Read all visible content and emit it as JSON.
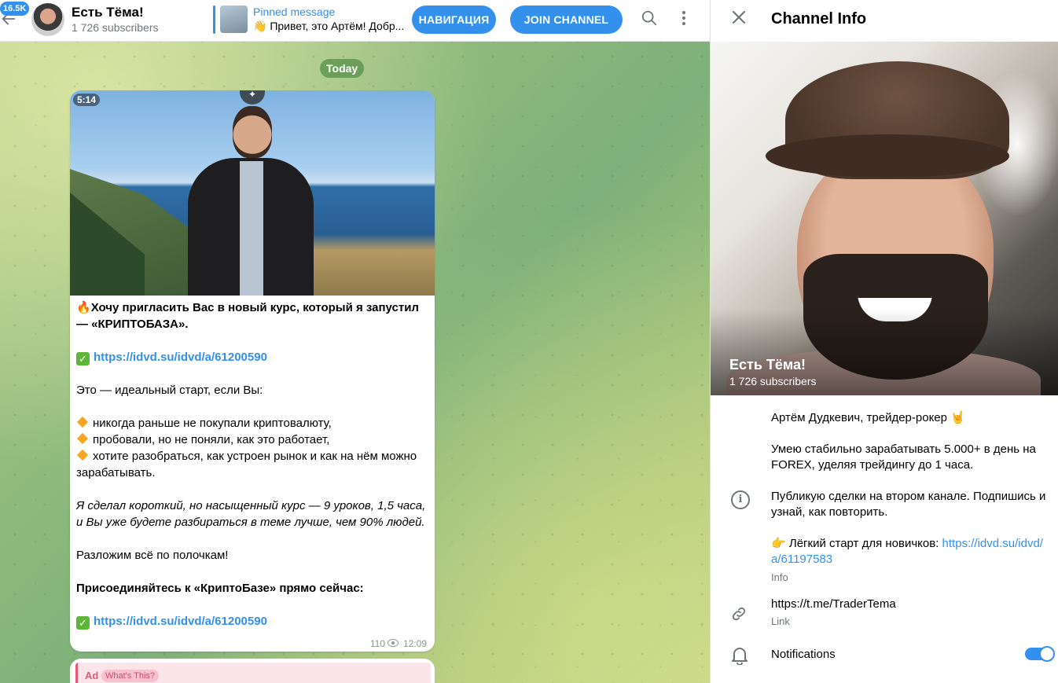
{
  "header": {
    "unread_count": "16.5K",
    "chat_title": "Есть Тёма!",
    "chat_subtitle": "1 726 subscribers",
    "pinned_title": "Pinned message",
    "pinned_text": "👋 Привет, это Артём! Добр...",
    "nav_button": "НАВИГАЦИЯ",
    "join_button": "JOIN CHANNEL"
  },
  "chat": {
    "date_separator": "Today",
    "message": {
      "video_duration": "5:14",
      "lines": {
        "intro": "Хочу пригласить Вас в новый курс, который я запустил — «КРИПТОБАЗА».",
        "link1": "https://idvd.su/idvd/a/61200590",
        "ideal": "Это — идеальный старт, если Вы:",
        "bullet1": "никогда раньше не покупали криптовалюту,",
        "bullet2": "пробовали, но не поняли, как это работает,",
        "bullet3": "хотите разобраться, как устроен рынок и как на нём можно зарабатывать.",
        "italic": "Я сделал короткий, но насыщенный курс — 9 уроков, 1,5 часа, и Вы уже будете разбираться в теме лучше, чем 90% людей.",
        "sort": "Разложим всё по полочкам!",
        "join": "Присоединяйтесь к «КриптоБазе» прямо сейчас:",
        "link2": "https://idvd.su/idvd/a/61200590"
      },
      "views": "110",
      "time": "12:09"
    },
    "ad": {
      "label": "Ad",
      "whats_this": "What's This?"
    }
  },
  "panel": {
    "title": "Channel Info",
    "channel_name": "Есть Тёма!",
    "channel_subscribers": "1 726 subscribers",
    "bio_line1": "Артём Дудкевич, трейдер-рокер 🤘",
    "bio_line2": "Умею стабильно зарабатывать 5.000+ в день на FOREX, уделяя трейдингу до 1 часа.",
    "bio_line3": "Публикую сделки на втором канале. Подпишись и узнай, как повторить.",
    "bio_line4_prefix": "👉 Лёгкий старт для новичков: ",
    "bio_line4_link": "https://idvd.su/idvd/a/61197583",
    "info_caption": "Info",
    "link_value": "https://t.me/TraderTema",
    "link_caption": "Link",
    "notifications_label": "Notifications",
    "notifications_on": true
  },
  "icons": {
    "back": "arrow-left-icon",
    "search": "search-icon",
    "more": "more-vertical-icon",
    "close": "close-icon",
    "info": "info-icon",
    "link": "link-icon",
    "bell": "bell-icon",
    "views": "eye-icon",
    "check": "check-mark-emoji",
    "fire": "fire-emoji",
    "diamond": "orange-diamond-emoji"
  },
  "colors": {
    "accent": "#3390ec",
    "ad_accent": "#e55a76"
  }
}
